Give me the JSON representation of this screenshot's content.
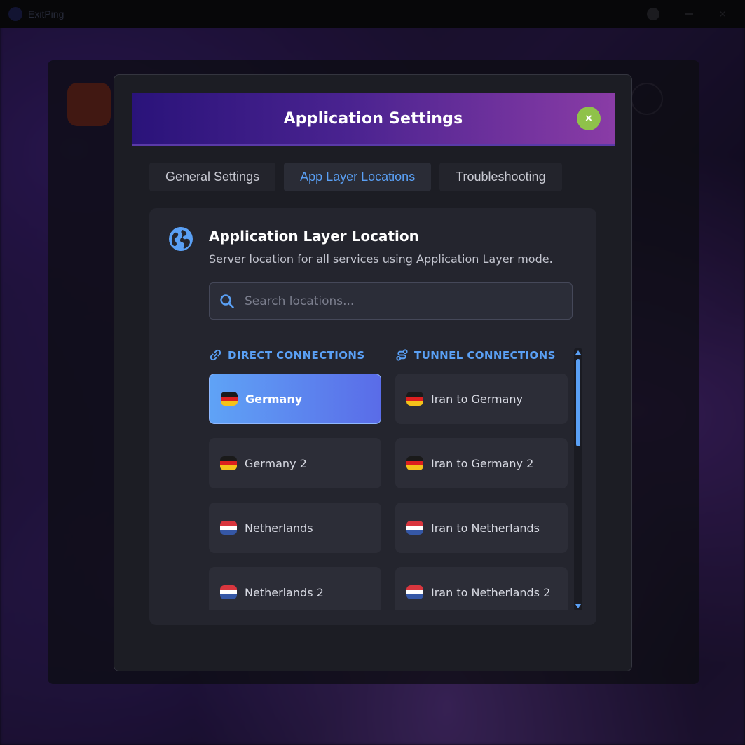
{
  "app": {
    "name": "ExitPing"
  },
  "modal": {
    "title": "Application Settings",
    "close_label": "×"
  },
  "tabs": [
    {
      "label": "General Settings",
      "active": false
    },
    {
      "label": "App Layer Locations",
      "active": true
    },
    {
      "label": "Troubleshooting",
      "active": false
    }
  ],
  "panel": {
    "icon": "globe-icon",
    "title": "Application Layer Location",
    "subtitle": "Server location for all services using Application Layer mode.",
    "search": {
      "placeholder": "Search locations...",
      "value": ""
    }
  },
  "columns": {
    "direct": {
      "heading": "DIRECT CONNECTIONS",
      "icon": "link-icon",
      "items": [
        {
          "label": "Germany",
          "flag": "de",
          "selected": true
        },
        {
          "label": "Germany 2",
          "flag": "de",
          "selected": false
        },
        {
          "label": "Netherlands",
          "flag": "nl",
          "selected": false
        },
        {
          "label": "Netherlands 2",
          "flag": "nl",
          "selected": false
        }
      ]
    },
    "tunnel": {
      "heading": "TUNNEL CONNECTIONS",
      "icon": "route-icon",
      "items": [
        {
          "label": "Iran to Germany",
          "flag": "de",
          "selected": false
        },
        {
          "label": "Iran to Germany 2",
          "flag": "de",
          "selected": false
        },
        {
          "label": "Iran to Netherlands",
          "flag": "nl",
          "selected": false
        },
        {
          "label": "Iran to Netherlands 2",
          "flag": "nl",
          "selected": false
        }
      ]
    }
  },
  "colors": {
    "accent": "#5aa0f5",
    "close_button": "#8fc24a",
    "header_gradient_start": "#2a137a",
    "header_gradient_end": "#8a3ca6",
    "selected_gradient_start": "#5fa3f6",
    "selected_gradient_end": "#5a6ce8"
  }
}
